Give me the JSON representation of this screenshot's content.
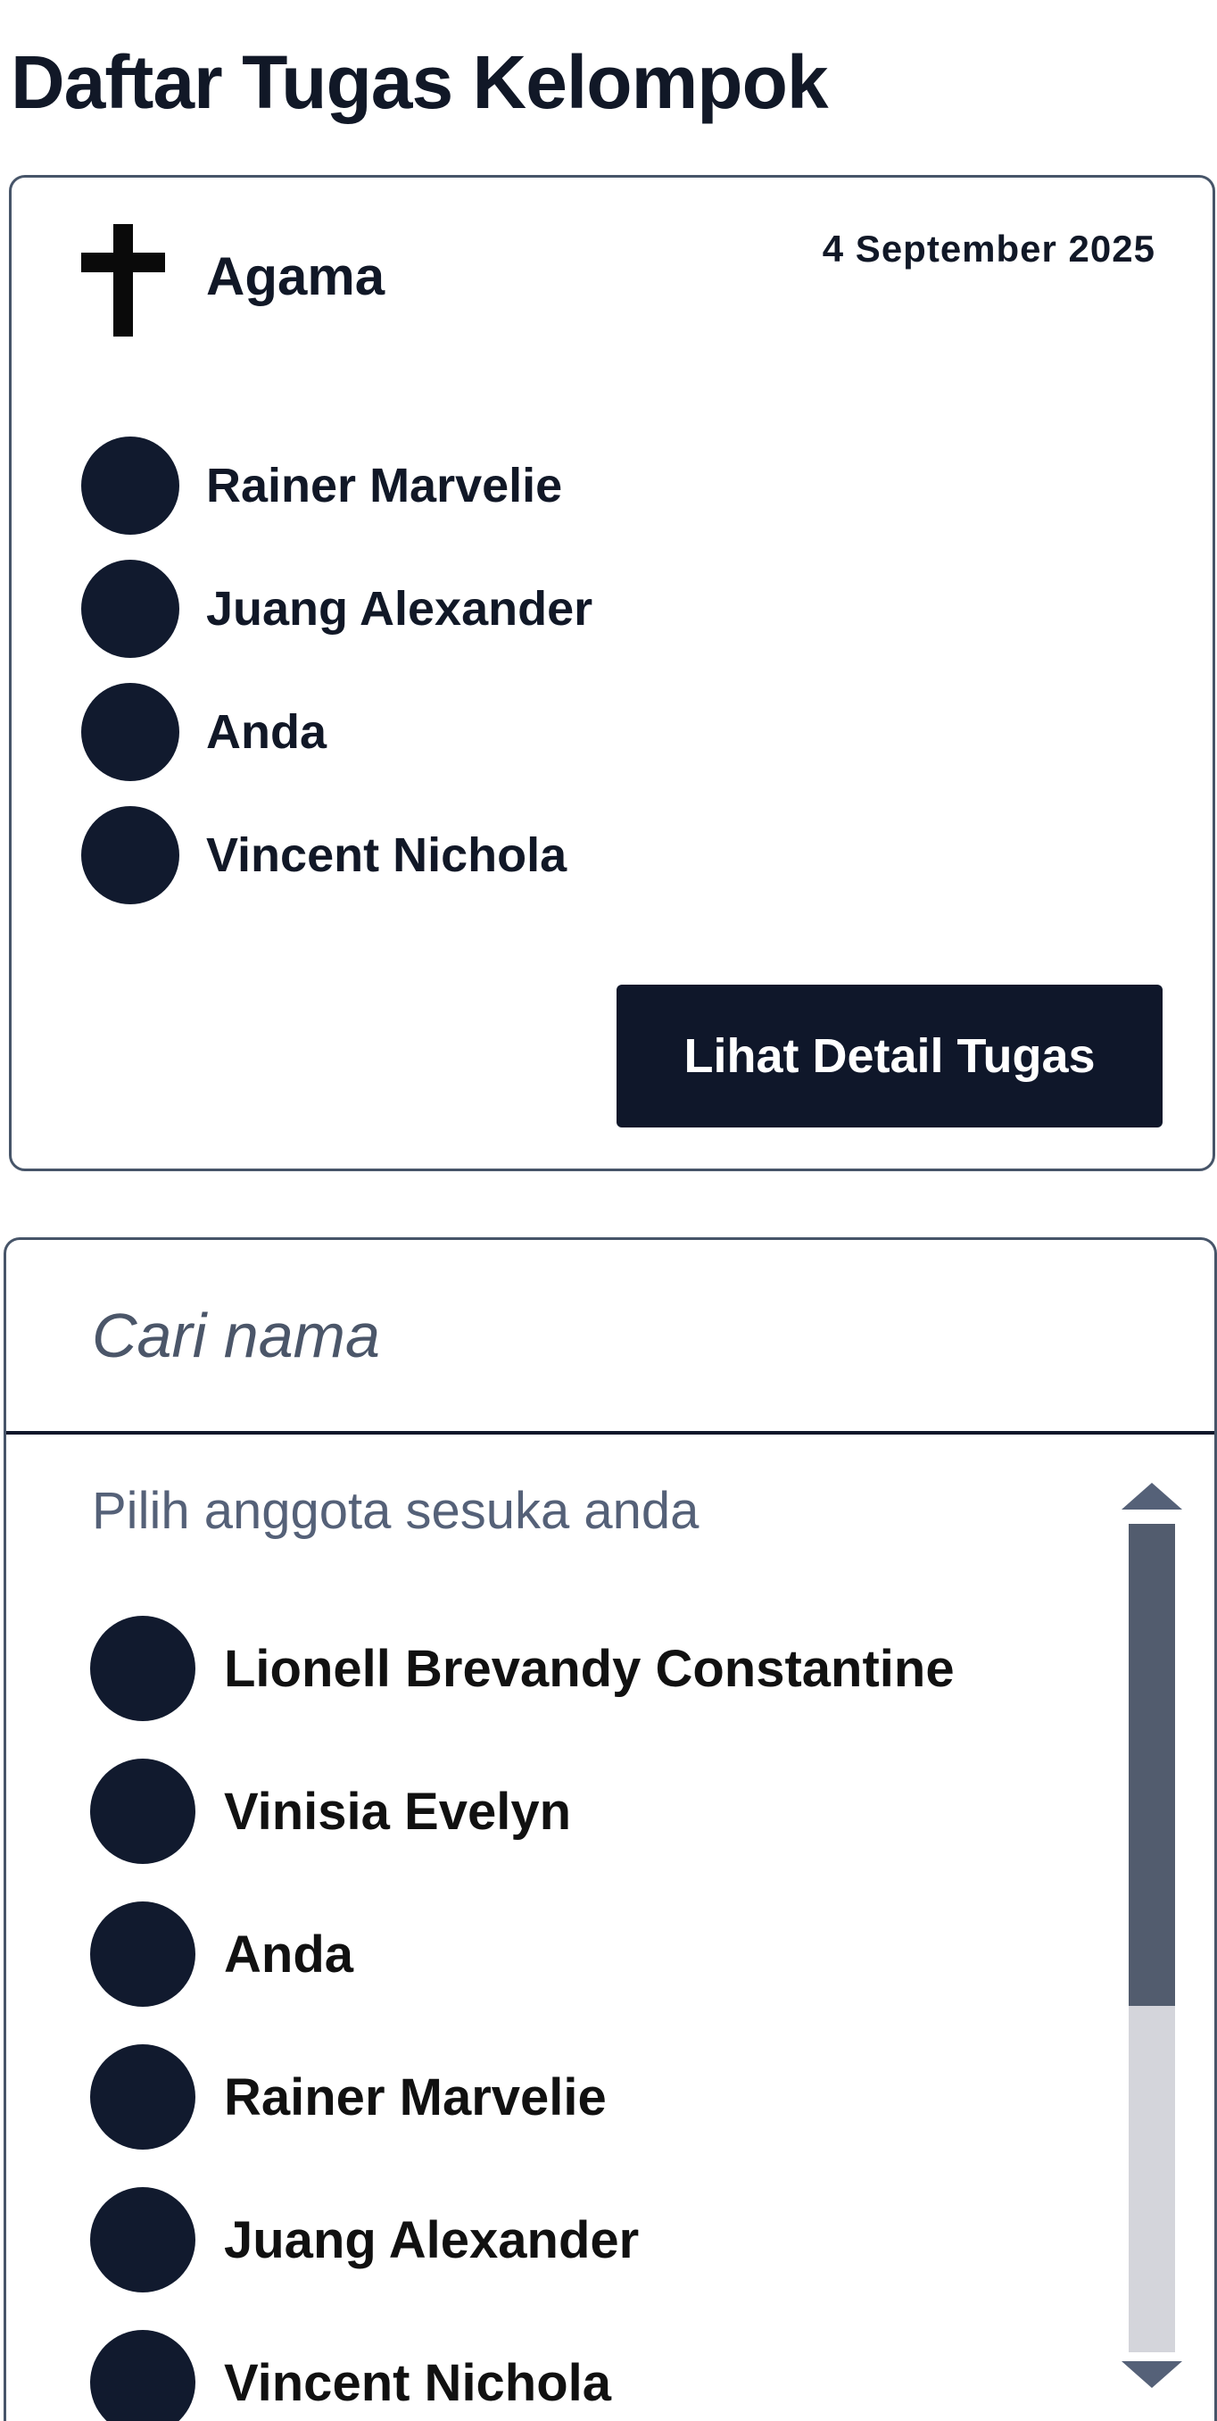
{
  "page": {
    "title": "Daftar Tugas Kelompok"
  },
  "task_card": {
    "subject": "Agama",
    "subject_icon": "cross-icon",
    "date": "4 September 2025",
    "members": [
      {
        "name": "Rainer Marvelie"
      },
      {
        "name": "Juang Alexander"
      },
      {
        "name": "Anda"
      },
      {
        "name": "Vincent Nichola"
      }
    ],
    "detail_button_label": "Lihat Detail Tugas"
  },
  "picker": {
    "search_placeholder": "Cari nama",
    "hint": "Pilih anggota sesuka anda",
    "options": [
      {
        "name": "Lionell Brevandy Constantine"
      },
      {
        "name": "Vinisia Evelyn"
      },
      {
        "name": "Anda"
      },
      {
        "name": "Rainer Marvelie"
      },
      {
        "name": "Juang Alexander"
      },
      {
        "name": "Vincent Nichola"
      }
    ],
    "scroll_position": 0.0
  },
  "colors": {
    "primary": "#0f172a",
    "avatar": "#111a2e",
    "border": "#475569",
    "muted_text": "#556178",
    "scroll_thumb": "#525c6e",
    "scroll_track": "#d4d5db"
  }
}
